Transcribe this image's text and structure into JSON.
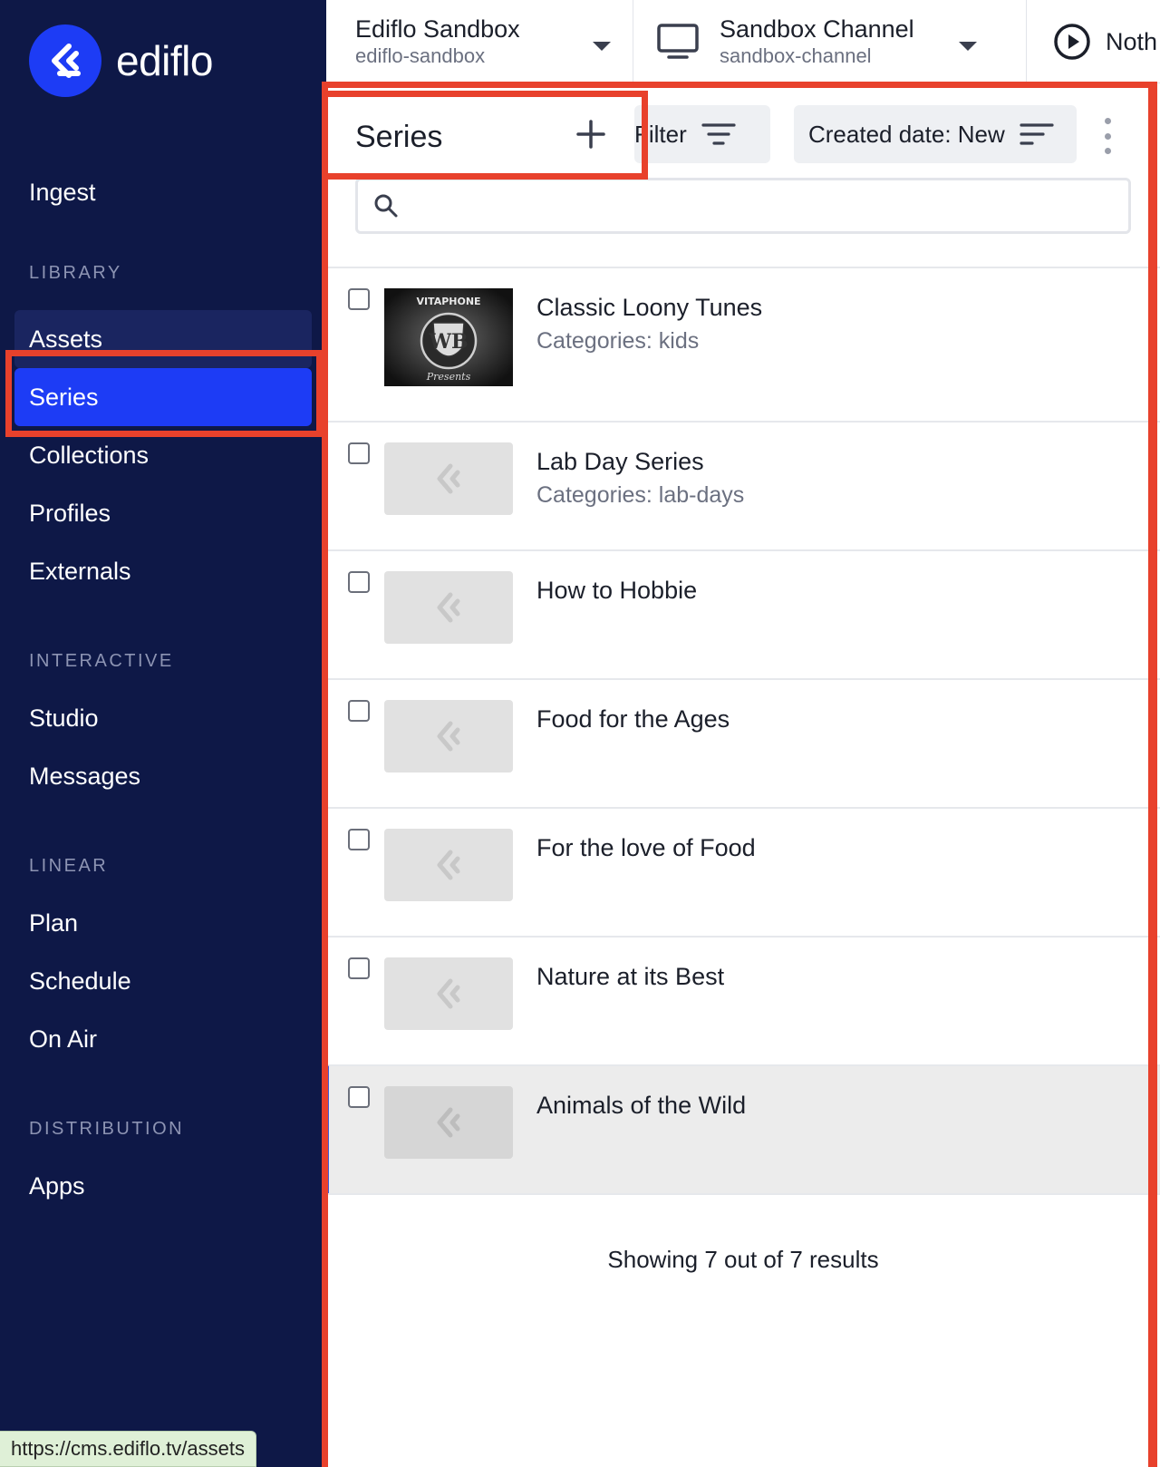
{
  "app": {
    "name": "ediflo"
  },
  "topbar": {
    "workspace": {
      "title": "Ediflo Sandbox",
      "slug": "ediflo-sandbox"
    },
    "channel": {
      "title": "Sandbox Channel",
      "slug": "sandbox-channel"
    },
    "now_playing": {
      "title": "Noth"
    }
  },
  "sidebar": {
    "ingest": "Ingest",
    "sections": {
      "library": "LIBRARY",
      "interactive": "INTERACTIVE",
      "linear": "LINEAR",
      "distribution": "DISTRIBUTION"
    },
    "items": {
      "assets": "Assets",
      "series": "Series",
      "collections": "Collections",
      "profiles": "Profiles",
      "externals": "Externals",
      "studio": "Studio",
      "messages": "Messages",
      "plan": "Plan",
      "schedule": "Schedule",
      "on_air": "On Air",
      "apps": "Apps"
    }
  },
  "main": {
    "title": "Series",
    "filter_label": "Filter",
    "sort_label": "Created date: New",
    "search": {
      "value": "",
      "placeholder": ""
    },
    "rows": [
      {
        "title": "Classic Loony Tunes",
        "subtitle": "Categories: kids",
        "thumb_text_top": "VITAPHONE",
        "thumb_text_bottom": "Presents"
      },
      {
        "title": "Lab Day Series",
        "subtitle": "Categories: lab-days"
      },
      {
        "title": "How to Hobbie",
        "subtitle": ""
      },
      {
        "title": "Food for the Ages",
        "subtitle": ""
      },
      {
        "title": "For the love of Food",
        "subtitle": ""
      },
      {
        "title": "Nature at its Best",
        "subtitle": ""
      },
      {
        "title": "Animals of the Wild",
        "subtitle": ""
      }
    ],
    "results_text": "Showing 7 out of 7 results"
  },
  "status_bar": {
    "url": "https://cms.ediflo.tv/assets"
  },
  "colors": {
    "sidebar_bg": "#0e1847",
    "accent": "#1d3cf5",
    "annotation": "#e8412c"
  }
}
